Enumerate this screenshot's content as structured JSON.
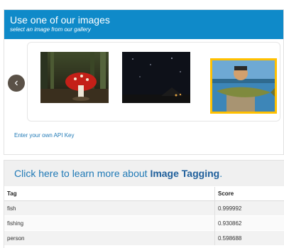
{
  "gallery": {
    "title": "Use one of our images",
    "subtitle": "select an image from our gallery",
    "api_link": "Enter your own API Key",
    "images": [
      {
        "name": "mushroom",
        "selected": false
      },
      {
        "name": "night-sky",
        "selected": false
      },
      {
        "name": "fishing",
        "selected": true
      }
    ],
    "accent": "#0f8ac9",
    "selected_border": "#ffc000"
  },
  "learn": {
    "prefix": "Click here to learn more about ",
    "highlight": "Image Tagging",
    "suffix": "."
  },
  "table": {
    "headers": [
      "Tag",
      "Score"
    ],
    "rows": [
      {
        "tag": "fish",
        "score": "0.999992"
      },
      {
        "tag": "fishing",
        "score": "0.930862"
      },
      {
        "tag": "person",
        "score": "0.598688"
      }
    ]
  }
}
